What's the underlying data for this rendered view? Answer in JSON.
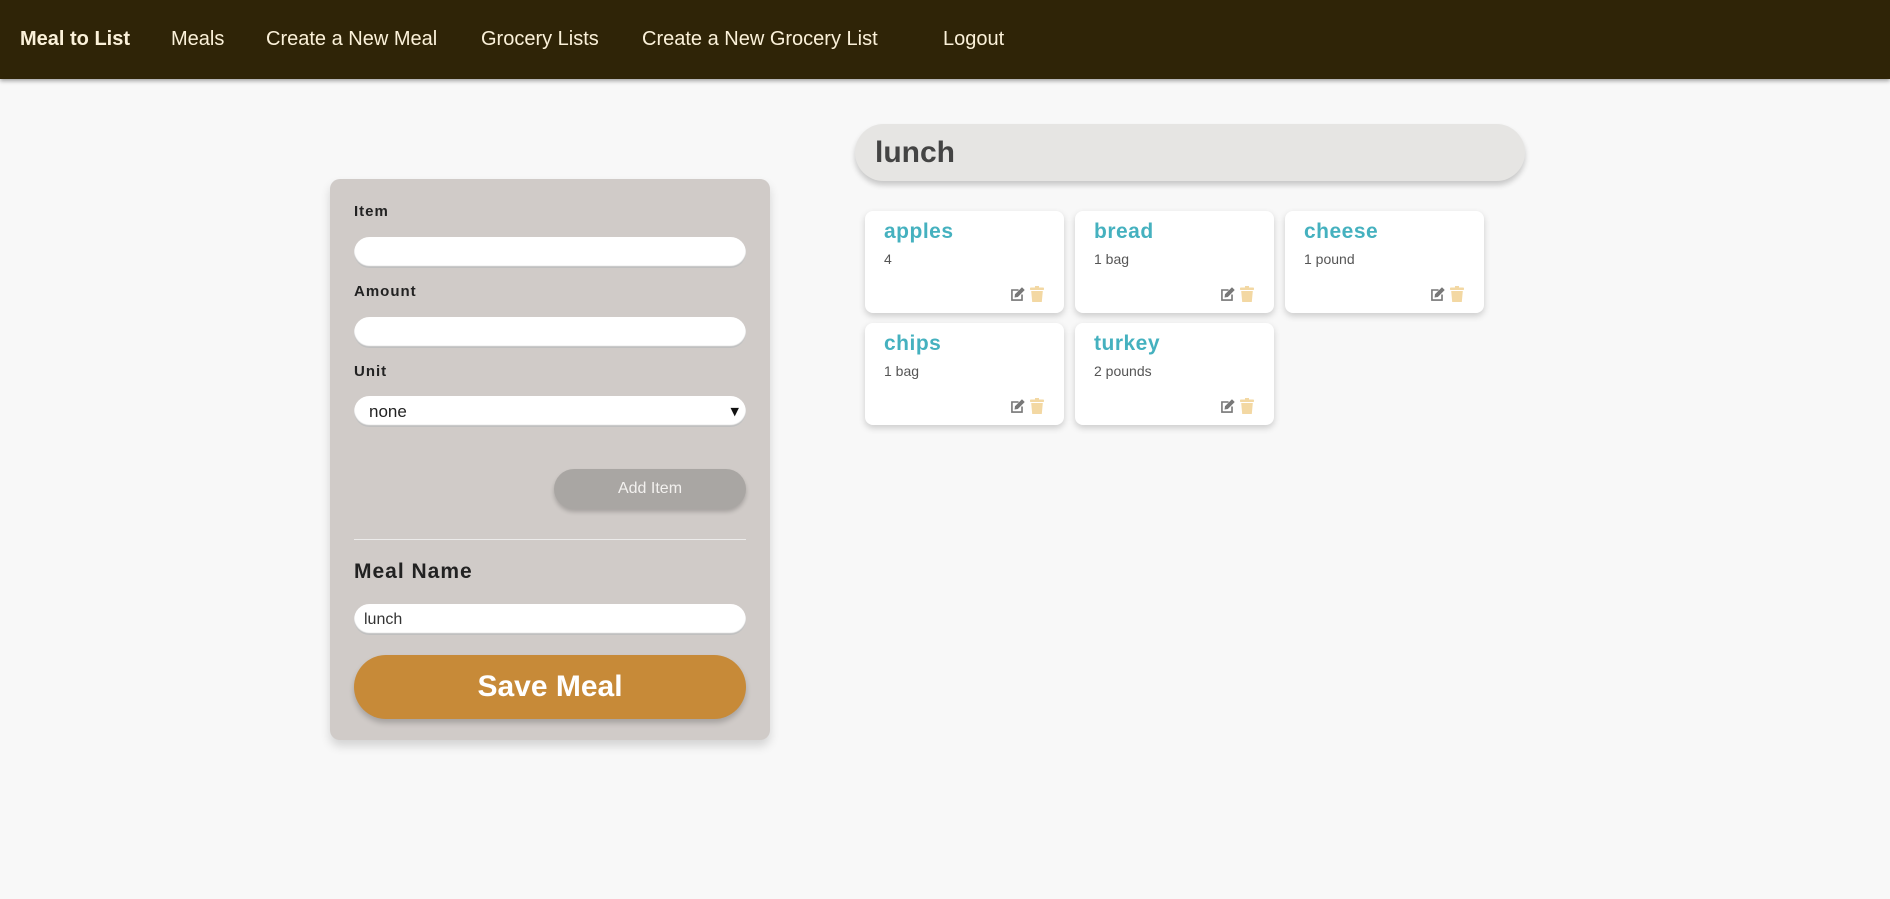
{
  "navbar": {
    "brand": "Meal to List",
    "links": [
      "Meals",
      "Create a New Meal",
      "Grocery Lists",
      "Create a New Grocery List",
      "Logout"
    ]
  },
  "form": {
    "item_label": "Item",
    "item_value": "",
    "amount_label": "Amount",
    "amount_value": "",
    "unit_label": "Unit",
    "unit_selected": "none",
    "add_item_label": "Add Item",
    "meal_name_label": "Meal Name",
    "meal_name_value": "lunch",
    "save_meal_label": "Save Meal"
  },
  "meal": {
    "title": "lunch",
    "items": [
      {
        "name": "apples",
        "amount": "4"
      },
      {
        "name": "bread",
        "amount": "1 bag"
      },
      {
        "name": "cheese",
        "amount": "1 pound"
      },
      {
        "name": "chips",
        "amount": "1 bag"
      },
      {
        "name": "turkey",
        "amount": "2 pounds"
      }
    ]
  },
  "icons": {
    "edit": "edit-icon",
    "delete": "trash-icon"
  },
  "colors": {
    "navbar_bg": "#2f2407",
    "nav_text": "#fbf1d9",
    "item_name": "#45b1bf",
    "save_button": "#c78a38",
    "trash_icon": "#f3d8a3",
    "edit_icon": "#777777"
  }
}
